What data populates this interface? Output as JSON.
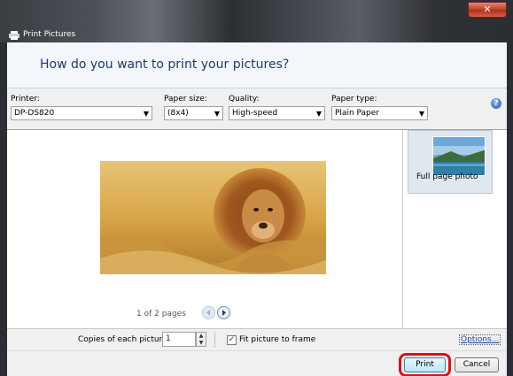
{
  "window": {
    "title": "Print Pictures",
    "close_glyph": "✕"
  },
  "header": {
    "question": "How do you want to print your pictures?"
  },
  "options": {
    "printer": {
      "label": "Printer:",
      "value": "DP-DS820"
    },
    "paper_size": {
      "label": "Paper size:",
      "value": "(8x4)"
    },
    "quality": {
      "label": "Quality:",
      "value": "High-speed"
    },
    "paper_type": {
      "label": "Paper type:",
      "value": "Plain Paper"
    },
    "help_glyph": "?"
  },
  "preview": {
    "pager": "1 of 2 pages"
  },
  "layouts": {
    "items": [
      {
        "label": "Full page photo"
      }
    ]
  },
  "bottom": {
    "copies_label": "Copies of each picture:",
    "copies_value": "1",
    "fit_label": "Fit picture to frame",
    "fit_checked": "✓",
    "options_link": "Options..."
  },
  "footer": {
    "print_label": "Print",
    "cancel_label": "Cancel"
  },
  "colors": {
    "accent": "#1e3a6e",
    "highlight_ring": "#e01010",
    "link": "#1a4fa3"
  }
}
